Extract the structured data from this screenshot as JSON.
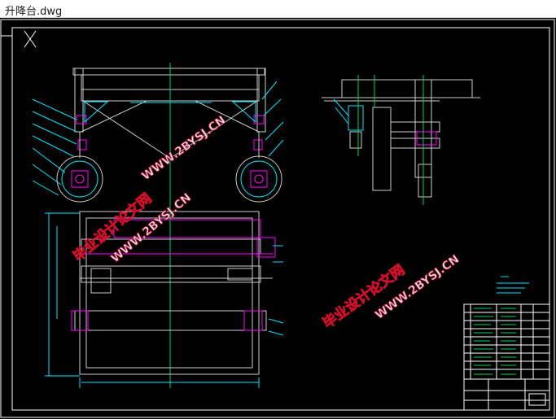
{
  "window": {
    "title": "升降台.dwg"
  },
  "watermarks": [
    {
      "cn": "毕业设计论文网",
      "url": "WWW.2BYSJ.CN"
    },
    {
      "cn": "毕业设计论文网",
      "url": "WWW.2BYSJ.CN"
    },
    {
      "cn": "毕业设计论文网",
      "url": "WWW.2BYSJ.CN"
    }
  ],
  "colors": {
    "background": "#000000",
    "frame": "#ffffff",
    "outline": "#cccccc",
    "cyan": "#00e5ff",
    "green": "#00d060",
    "magenta": "#ff00ff",
    "watermark_fill": "#e8e8ff",
    "watermark_stroke": "#d0102a"
  }
}
